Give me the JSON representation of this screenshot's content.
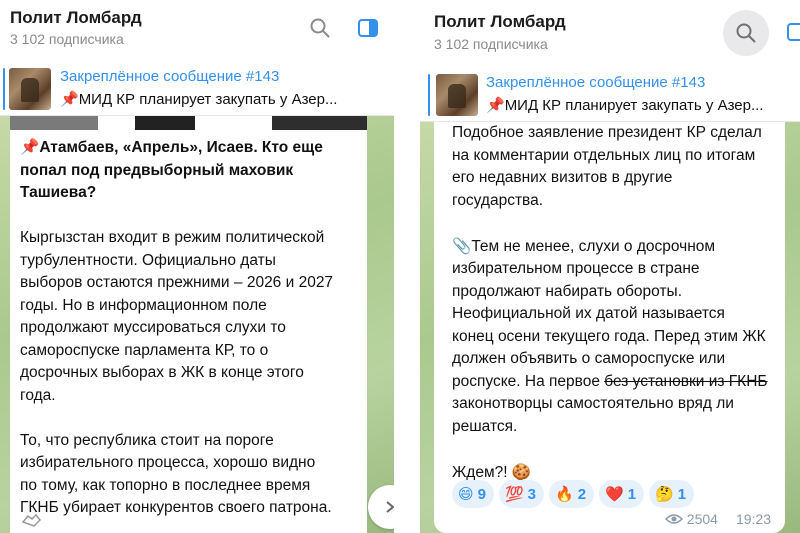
{
  "channel": {
    "title": "Полит Ломбард",
    "subscribers": "3 102 подписчика"
  },
  "pinned": {
    "title": "Закреплённое сообщение #143",
    "text_left": "МИД КР планирует закупать у Азер...",
    "text_right": "МИД КР планирует закупать у Азер...",
    "emoji": "📌"
  },
  "left_message": {
    "headline_emoji": "📌",
    "headline": [
      "Атамбаев, «Апрель», Исаев. Кто еще",
      "попал под предвыборный маховик",
      "Ташиева?"
    ],
    "paragraph1": [
      "Кыргызстан входит в режим политической",
      "турбулентности. Официально даты",
      "выборов остаются прежними – 2026 и 2027",
      "годы. Но в информационном поле",
      "продолжают муссироваться слухи то",
      "самороспуске парламента КР, то о",
      "досрочных выборах в ЖК в конце этого",
      "года."
    ],
    "paragraph2": [
      "То, что республика стоит на пороге",
      "избирательного процесса, хорошо видно",
      "по тому, как топорно в последнее время",
      "ГКНБ убирает конкурентов своего патрона."
    ]
  },
  "right_message": {
    "paragraph1": [
      "Подобное заявление президент КР сделал",
      "на комментарии отдельных лиц по итогам",
      "его недавних визитов в другие",
      "государства."
    ],
    "paragraph2_emoji": "📎",
    "paragraph2": [
      "Тем не менее, слухи о досрочном",
      "избирательном процессе в стране",
      "продолжают набирать обороты.",
      "Неофициальной их датой называется",
      "конец осени текущего года. Перед этим ЖК",
      "должен объявить о самороспуске или",
      "роспуске. На первое "
    ],
    "strike_text": "без установки из ГКНБ",
    "paragraph2_tail": [
      "законотворцы самостоятельно вряд ли",
      "решатся."
    ],
    "closing": "Ждем?!",
    "closing_emoji": "🍪",
    "reactions": [
      {
        "emoji": "😄",
        "count": "9"
      },
      {
        "emoji": "💯",
        "count": "3"
      },
      {
        "emoji": "🔥",
        "count": "2"
      },
      {
        "emoji": "❤️",
        "count": "1"
      },
      {
        "emoji": "🤔",
        "count": "1"
      }
    ],
    "views": "2504",
    "time": "19:23"
  },
  "colors": {
    "accent": "#3390ec",
    "chat_bg": "#a9c98e"
  }
}
